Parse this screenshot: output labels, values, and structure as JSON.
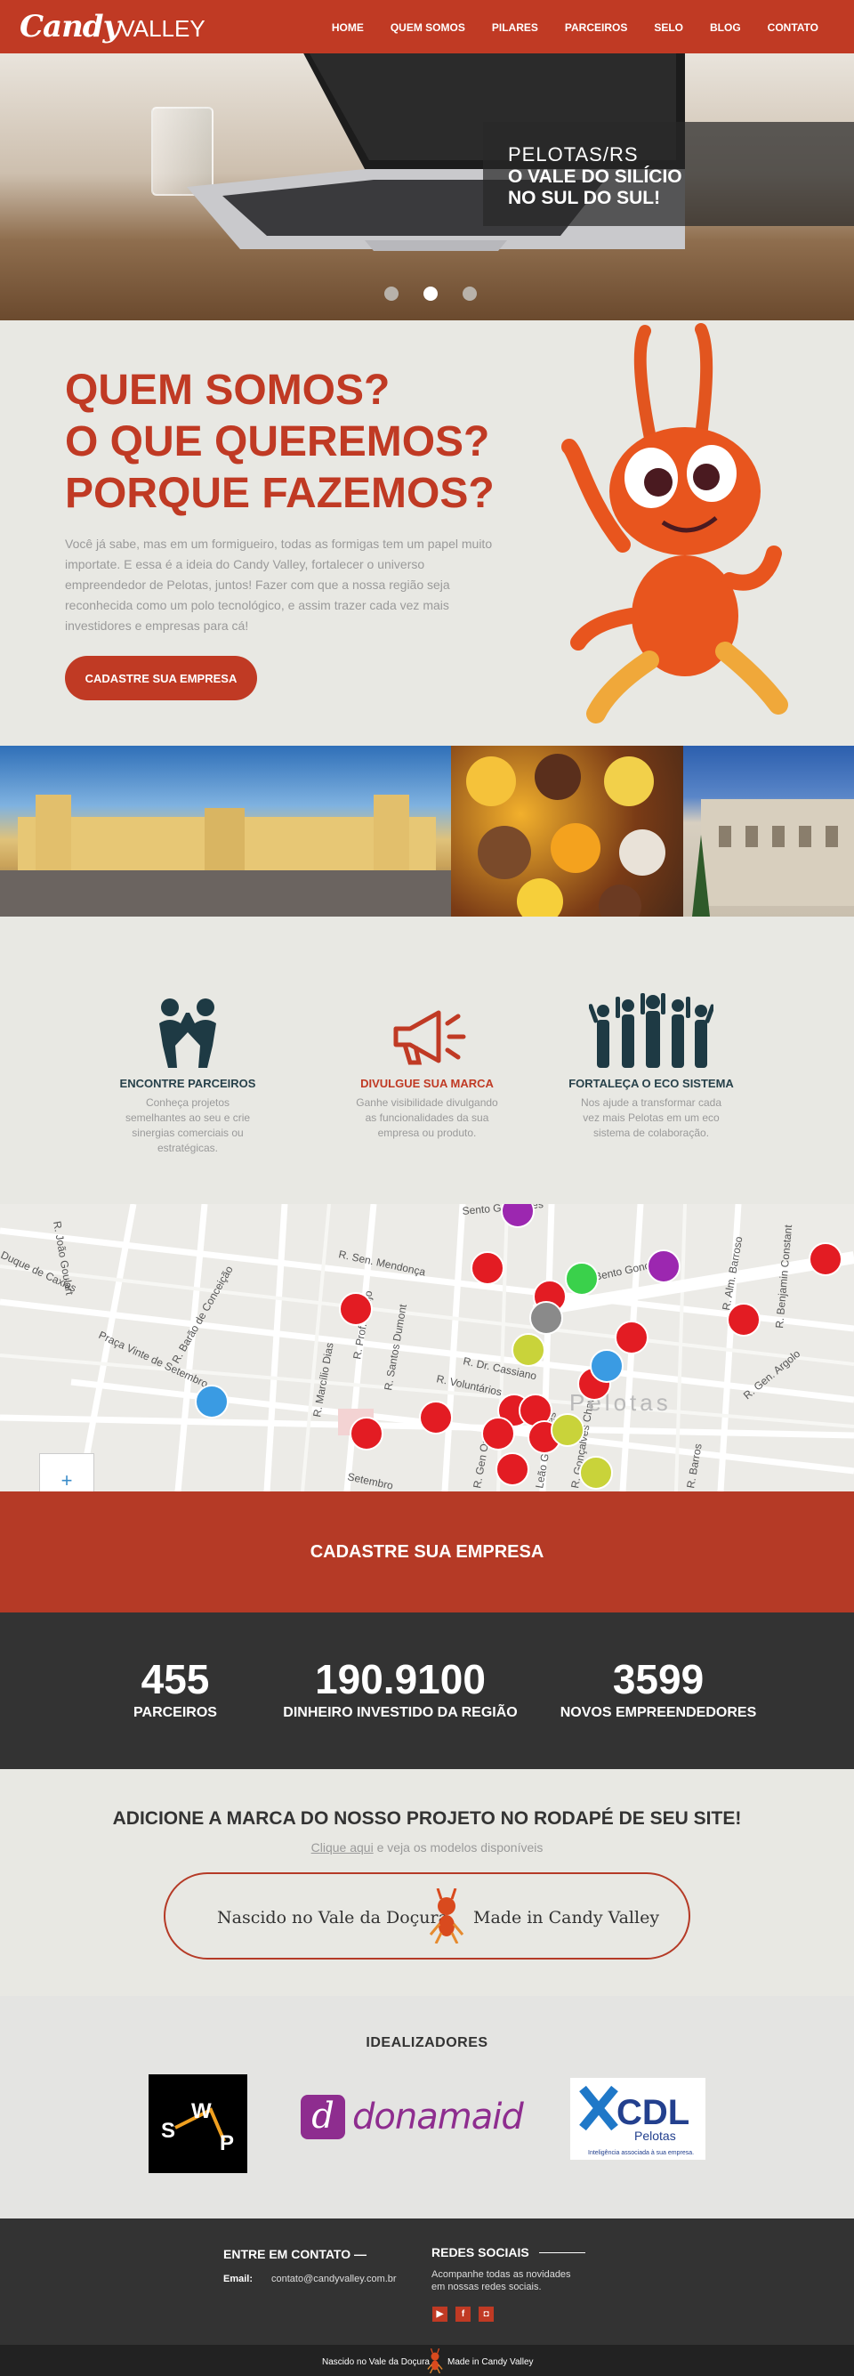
{
  "nav": {
    "logo_script": "Candy",
    "logo_word": "VALLEY",
    "items": [
      "HOME",
      "QUEM SOMOS",
      "PILARES",
      "PARCEIROS",
      "SELO",
      "BLOG",
      "CONTATO"
    ]
  },
  "hero": {
    "caption_line1": "PELOTAS/RS",
    "caption_line2": "O VALE DO SILÍCIO",
    "caption_line3": "NO SUL DO SUL!",
    "slides": 3,
    "active_slide": 2
  },
  "about": {
    "title_lines": [
      "QUEM SOMOS?",
      "O QUE QUEREMOS?",
      "PORQUE FAZEMOS?"
    ],
    "text": "Você já sabe, mas em um formigueiro, todas as formigas tem um papel muito importate. E essa é a ideia do Candy Valley, fortalecer o universo empreendedor de Pelotas, juntos! Fazer com que a nossa região seja reconhecida como um polo tecnológico, e assim trazer cada vez mais investidores e empresas para cá!",
    "button": "CADASTRE SUA EMPRESA"
  },
  "features": [
    {
      "title": "ENCONTRE PARCEIROS",
      "text": "Conheça projetos semelhantes ao seu e crie sinergias comerciais ou estratégicas.",
      "icon": "handshake-people-icon"
    },
    {
      "title": "DIVULGUE SUA MARCA",
      "text": "Ganhe visibilidade divulgando as funcionalidades da sua empresa ou produto.",
      "icon": "megaphone-icon"
    },
    {
      "title": "FORTALEÇA O ECO SISTEMA",
      "text": "Nos ajude a transformar cada vez mais  Pelotas em um eco sistema de colaboração.",
      "icon": "group-people-icon"
    }
  ],
  "map": {
    "city_label": "Pelotas",
    "streets": [
      "Sento Gonçalves",
      "R. Sen. Mendonça",
      "Av. Bento Gonçalves",
      "R. Dr. Cassiano",
      "R. Voluntários",
      "R. Santos Dumont",
      "R. Prof. Araújo",
      "R. Marcílio Dias",
      "R. Barão de Conceição",
      "Praça Vinte de Setembro",
      "R. Gen. Argolo",
      "R. Alm. Barroso",
      "R. Benjamin Constant",
      "R. Gonçalves Chaves",
      "Setembro",
      "R. Gen Osório",
      "R. Barros",
      "Leão Gonçalves",
      "R. João Goulart",
      "Duque de Caxias"
    ],
    "zoom_label": "+"
  },
  "cta": {
    "button": "CADASTRE SUA EMPRESA"
  },
  "stats": [
    {
      "value": "455",
      "label": "PARCEIROS"
    },
    {
      "value": "190.9100",
      "label": "DINHEIRO INVESTIDO DA REGIÃO"
    },
    {
      "value": "3599",
      "label": "NOVOS EMPREENDEDORES"
    }
  ],
  "brand": {
    "title": "ADICIONE A MARCA DO NOSSO PROJETO NO RODAPÉ DE SEU SITE!",
    "link": "Clique aqui",
    "sub": " e veja os modelos disponíveis",
    "badge_left": "Nascido no Vale da Doçura",
    "badge_right": "Made in Candy Valley"
  },
  "ideal": {
    "title": "IDEALIZADORES",
    "swp_letters": [
      "S",
      "W",
      "P"
    ],
    "dona_mark": "d",
    "dona_word": "donamaid",
    "cdl_word": "CDL",
    "cdl_city": "Pelotas",
    "cdl_tag": "Inteligência associada à sua empresa."
  },
  "footer": {
    "contact_title": "ENTRE EM CONTATO —",
    "email_label": "Email:",
    "email": "contato@candyvalley.com.br",
    "social_title": "REDES SOCIAIS",
    "social_text": "Acompanhe todas as novidades em nossas redes sociais.",
    "social_icons": [
      "youtube-icon",
      "facebook-icon",
      "instagram-icon"
    ],
    "bottom_left": "Nascido no Vale da Doçura",
    "bottom_right": "Made in Candy Valley"
  },
  "colors": {
    "brand_red": "#c03a24",
    "dark": "#333333",
    "bg": "#e8e8e3"
  }
}
